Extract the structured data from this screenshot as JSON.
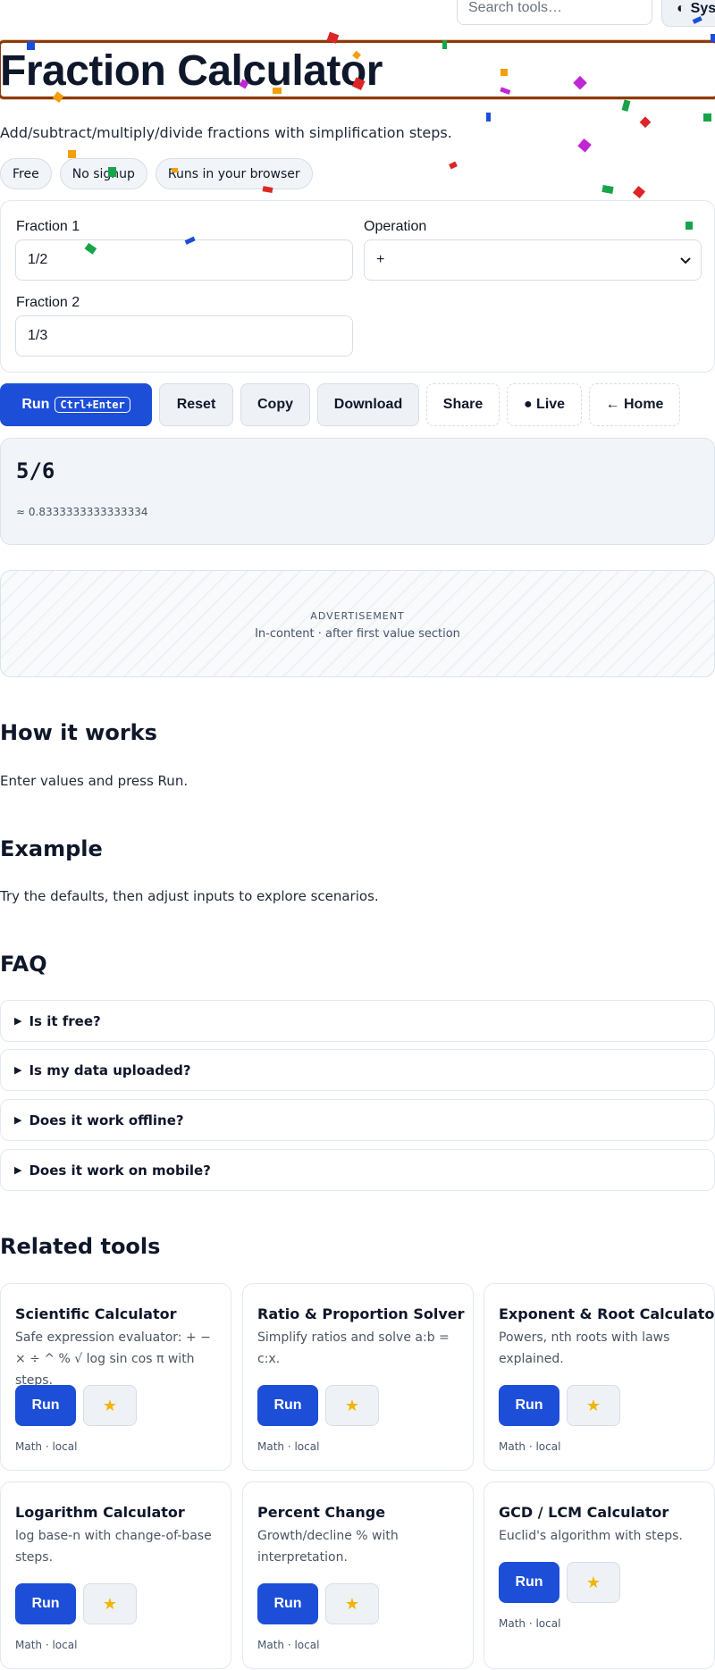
{
  "header": {
    "search_placeholder": "Search tools…",
    "theme_label": "System"
  },
  "page": {
    "title": "Fraction Calculator",
    "subtitle": "Add/subtract/multiply/divide fractions with simplification steps.",
    "chips": [
      "Free",
      "No signup",
      "Runs in your browser"
    ]
  },
  "form": {
    "fraction1_label": "Fraction 1",
    "fraction1_value": "1/2",
    "operation_label": "Operation",
    "operation_value": "+",
    "fraction2_label": "Fraction 2",
    "fraction2_value": "1/3"
  },
  "actions": {
    "run": "Run",
    "run_shortcut": "Ctrl+Enter",
    "reset": "Reset",
    "copy": "Copy",
    "download": "Download",
    "share": "Share",
    "live": "● Live",
    "home": "← Home"
  },
  "result": {
    "value": "5/6",
    "approx": "≈ 0.8333333333333334"
  },
  "ad": {
    "label": "ADVERTISEMENT",
    "desc": "In-content · after first value section"
  },
  "how": {
    "heading": "How it works",
    "text": "Enter values and press Run."
  },
  "example": {
    "heading": "Example",
    "text": "Try the defaults, then adjust inputs to explore scenarios."
  },
  "faq": {
    "heading": "FAQ",
    "items": [
      "Is it free?",
      "Is my data uploaded?",
      "Does it work offline?",
      "Does it work on mobile?"
    ]
  },
  "related": {
    "heading": "Related tools",
    "tools": [
      {
        "title": "Scientific Calculator",
        "desc": "Safe expression evaluator: + − × ÷ ^ % √ log sin cos π with steps.",
        "run": "Run",
        "meta": "Math · local"
      },
      {
        "title": "Ratio & Proportion Solver",
        "desc": "Simplify ratios and solve a:b = c:x.",
        "run": "Run",
        "meta": "Math · local"
      },
      {
        "title": "Exponent & Root Calculator",
        "desc": "Powers, nth roots with laws explained.",
        "run": "Run",
        "meta": "Math · local"
      },
      {
        "title": "Logarithm Calculator",
        "desc": "log base-n with change-of-base steps.",
        "run": "Run",
        "meta": "Math · local"
      },
      {
        "title": "Percent Change",
        "desc": "Growth/decline % with interpretation.",
        "run": "Run",
        "meta": "Math · local"
      },
      {
        "title": "GCD / LCM Calculator",
        "desc": "Euclid's algorithm with steps.",
        "run": "Run",
        "meta": "Math · local"
      }
    ]
  },
  "icons": {
    "theme": "half-circle-icon",
    "star": "star-icon",
    "chevron": "chevron-down-icon",
    "faq_toggle": "triangle-right-icon"
  },
  "colors": {
    "primary": "#1d4ed8",
    "title_outline": "#8b3a0f",
    "soft_bg": "#eef2f7"
  }
}
